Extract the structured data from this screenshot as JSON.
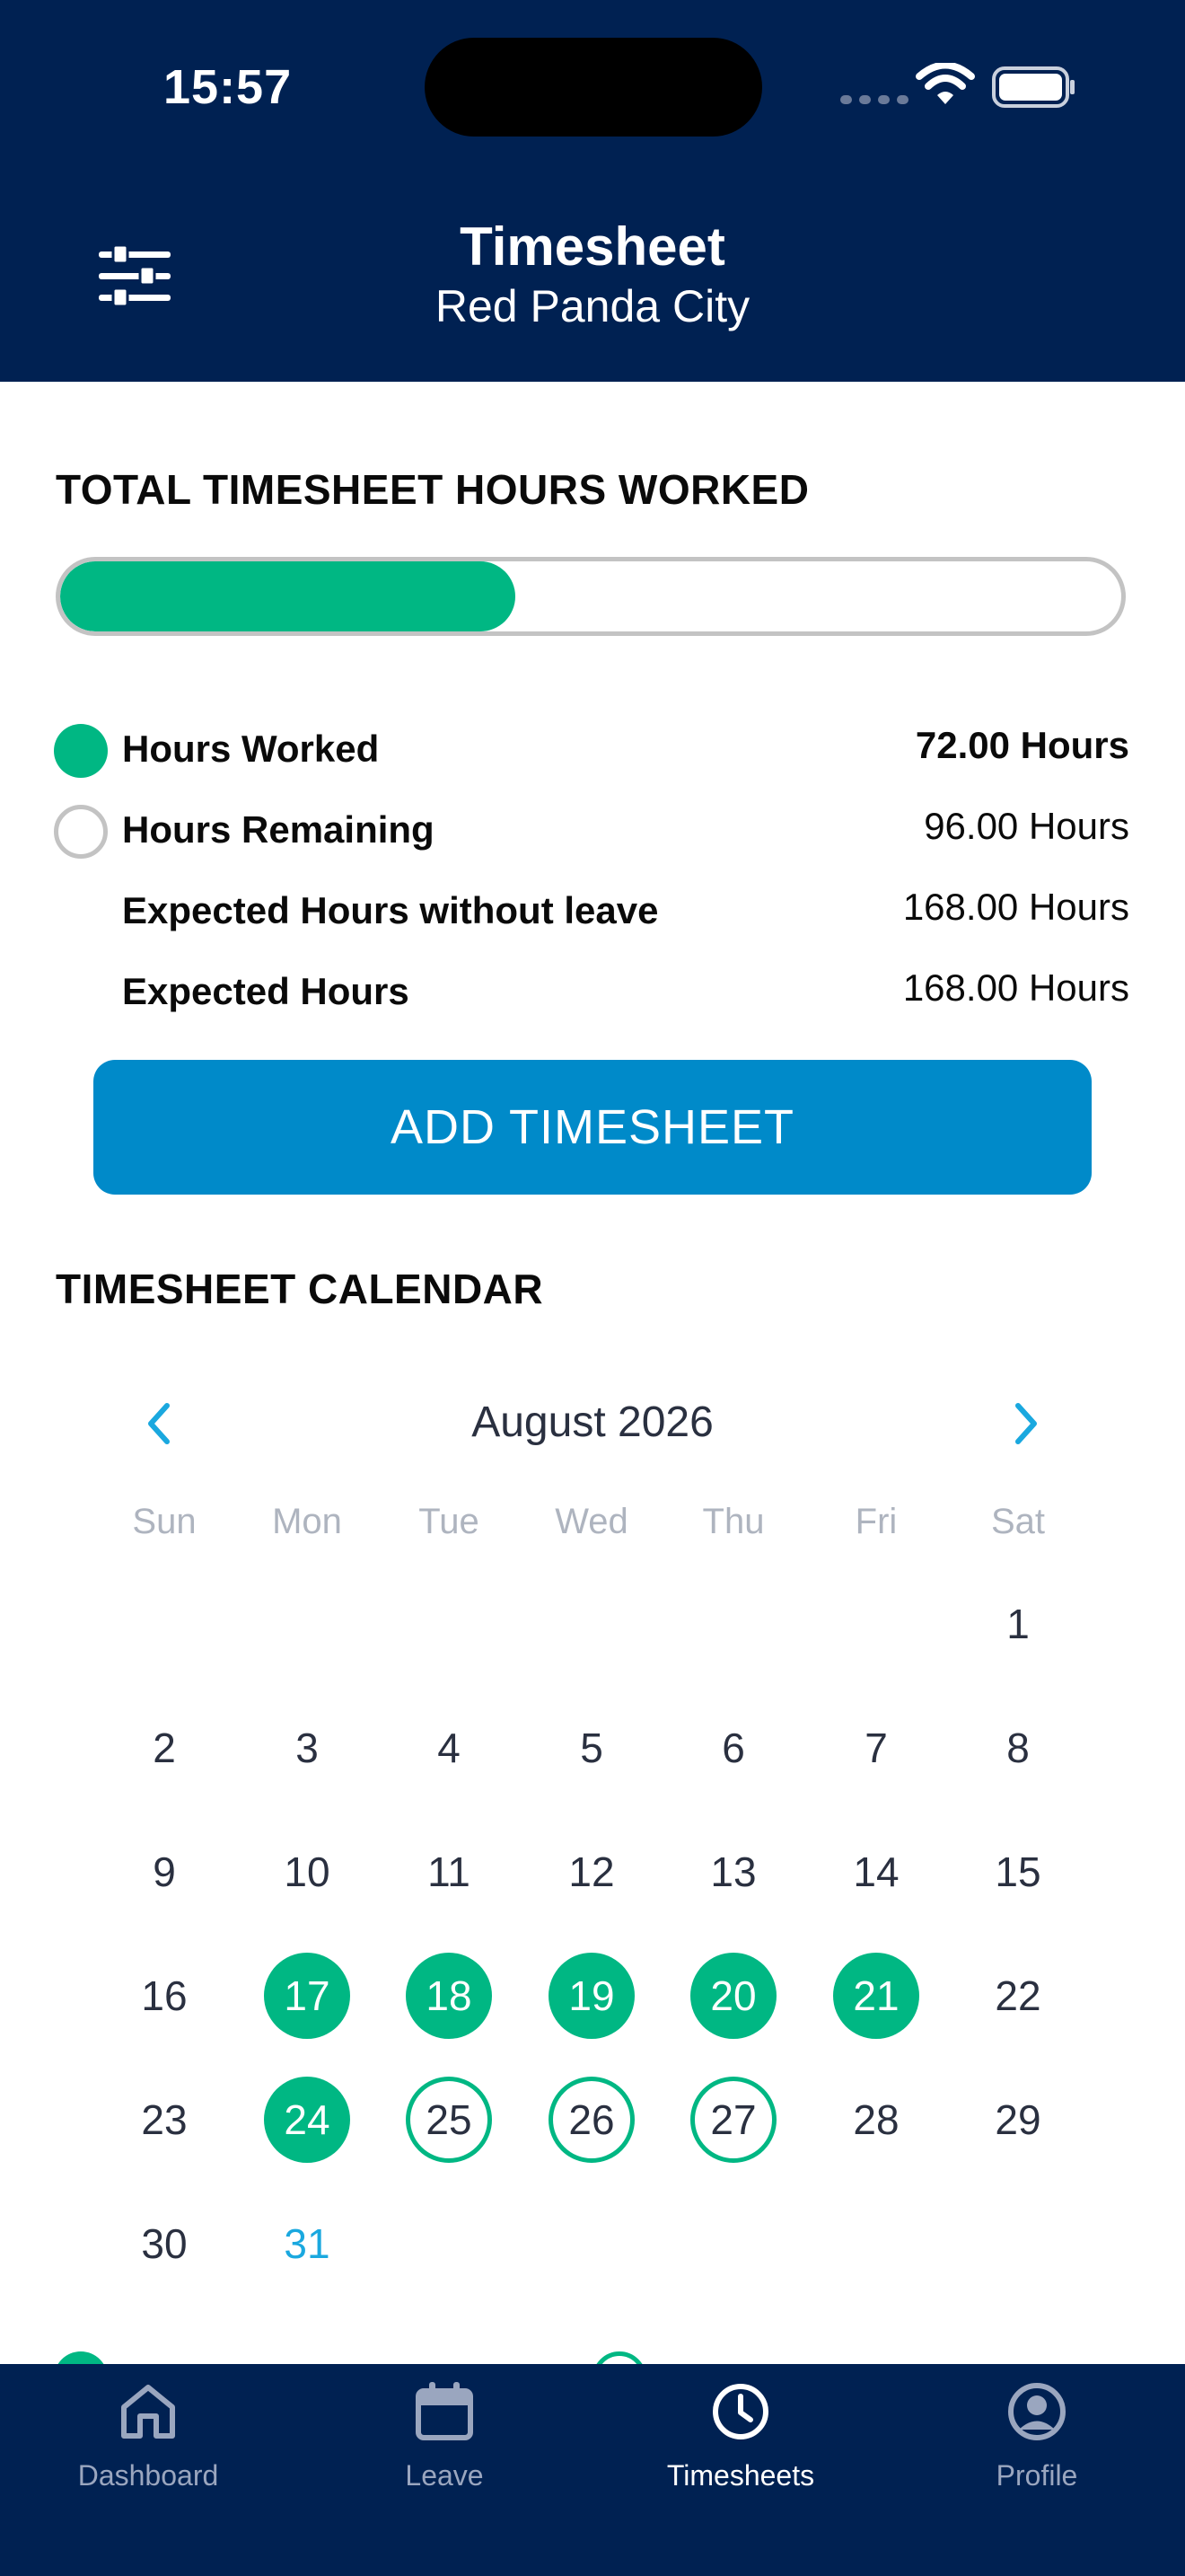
{
  "status_bar": {
    "time": "15:57"
  },
  "header": {
    "title": "Timesheet",
    "subtitle": "Red Panda City"
  },
  "summary": {
    "section_title": "TOTAL TIMESHEET HOURS WORKED",
    "progress_fraction": 0.4286,
    "rows": [
      {
        "label": "Hours Worked",
        "value": "72.00 Hours",
        "dot": "filled"
      },
      {
        "label": "Hours Remaining",
        "value": "96.00 Hours",
        "dot": "outline"
      },
      {
        "label": "Expected Hours without leave",
        "value": "168.00 Hours",
        "dot": "none"
      },
      {
        "label": "Expected Hours",
        "value": "168.00 Hours",
        "dot": "none"
      }
    ],
    "add_button_label": "ADD TIMESHEET"
  },
  "calendar": {
    "section_title": "TIMESHEET CALENDAR",
    "month_label": "August 2026",
    "weekdays": [
      "Sun",
      "Mon",
      "Tue",
      "Wed",
      "Thu",
      "Fri",
      "Sat"
    ],
    "first_weekday_index": 6,
    "days_in_month": 31,
    "filled_days": [
      17,
      18,
      19,
      20,
      21,
      24
    ],
    "outlined_days": [
      25,
      26,
      27
    ],
    "highlight_day": 31
  },
  "colors": {
    "navy": "#002152",
    "green": "#00b783",
    "blue_button": "#008ac9",
    "accent": "#1aa8df"
  },
  "tabs": [
    {
      "label": "Dashboard",
      "icon": "home-icon",
      "active": false
    },
    {
      "label": "Leave",
      "icon": "calendar-icon",
      "active": false
    },
    {
      "label": "Timesheets",
      "icon": "clock-icon",
      "active": true
    },
    {
      "label": "Profile",
      "icon": "user-circle-icon",
      "active": false
    }
  ]
}
